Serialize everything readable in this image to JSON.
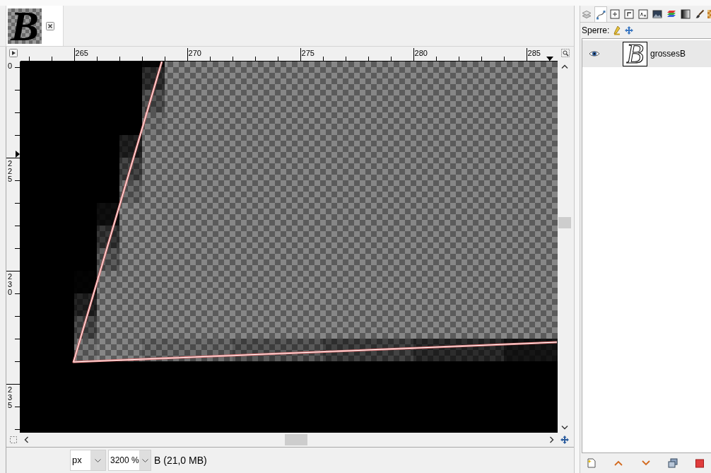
{
  "image_tab": {
    "thumbnail_letter": "B"
  },
  "rulers": {
    "horizontal": [
      "265",
      "270",
      "275",
      "280",
      "285"
    ],
    "vertical": [
      "0",
      "225",
      "230",
      "235"
    ]
  },
  "status_bar": {
    "unit": "px",
    "zoom": "3200 %",
    "image_info": "B (21,0 MB)"
  },
  "dock_tabs": [
    {
      "selected": false
    },
    {
      "selected": true
    },
    {
      "selected": false
    },
    {
      "selected": false
    },
    {
      "selected": false
    },
    {
      "selected": false
    },
    {
      "selected": false
    },
    {
      "selected": false
    },
    {
      "selected": false
    },
    {
      "selected": false
    }
  ],
  "lock": {
    "label": "Sperre:"
  },
  "layers": [
    {
      "name": "grossesB",
      "thumbnail_letter": "B",
      "visible": true,
      "selected": true
    }
  ]
}
